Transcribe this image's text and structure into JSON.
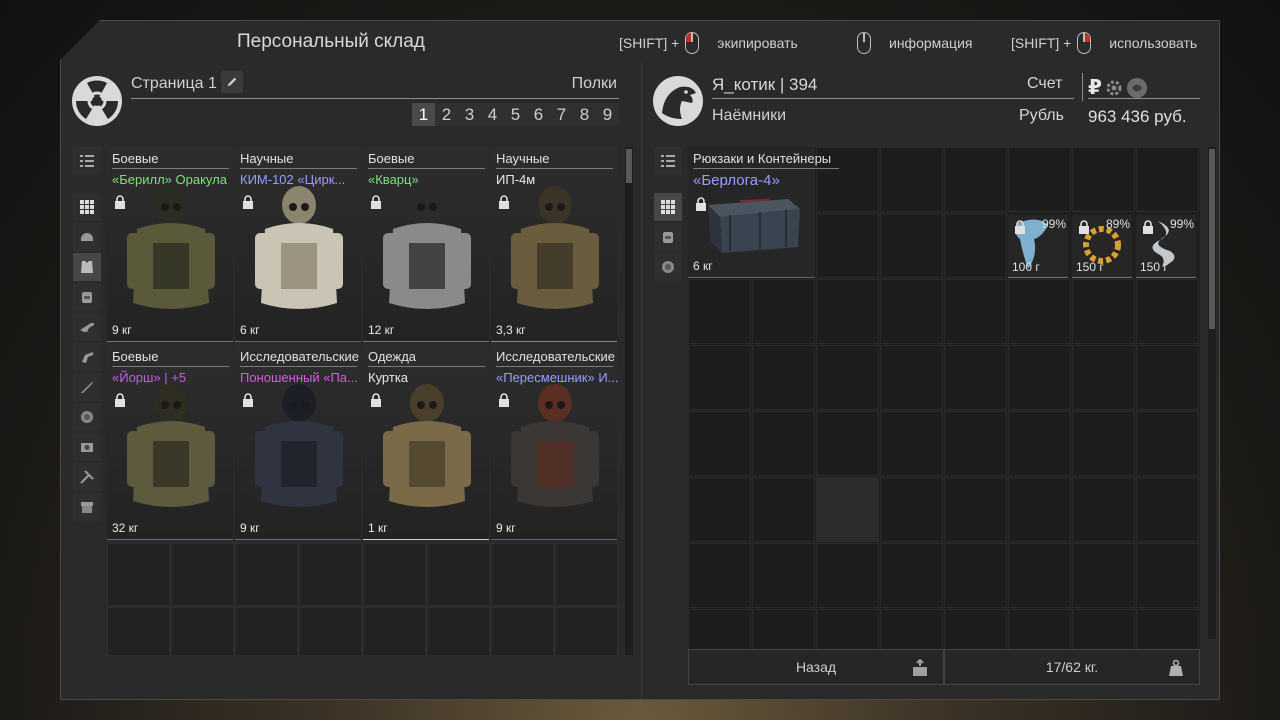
{
  "topbar": {
    "title": "Персональный склад",
    "hints": [
      {
        "prefix": "[SHIFT] +",
        "mouse": "left",
        "label": "экипировать"
      },
      {
        "prefix": "",
        "mouse": "none",
        "label": "информация"
      },
      {
        "prefix": "[SHIFT] +",
        "mouse": "right",
        "label": "использовать"
      }
    ]
  },
  "left": {
    "page_label": "Страница 1",
    "shelves_label": "Полки",
    "pages": [
      "1",
      "2",
      "3",
      "4",
      "5",
      "6",
      "7",
      "8",
      "9"
    ],
    "active_page": "1",
    "sidebar_icons": [
      "list-icon",
      "grid-icon",
      "helmet-icon",
      "armor-icon",
      "backpack-icon",
      "rifle-icon",
      "pistol-icon",
      "knife-icon",
      "artifact-icon",
      "device-icon",
      "tools-icon",
      "box-icon"
    ],
    "items": [
      {
        "cat": "Боевые",
        "name": "«Берилл» Оракула",
        "name_color": "#7fe07f",
        "weight": "9 кг",
        "border": "#3f9d3f",
        "body": "#5a5a3a",
        "accent": "#2c2c22"
      },
      {
        "cat": "Научные",
        "name": "КИМ-102 «Цирк...",
        "name_color": "#9c9cff",
        "weight": "6 кг",
        "border": "#5b5bb8",
        "body": "#c9c4b4",
        "accent": "#8c846f"
      },
      {
        "cat": "Боевые",
        "name": "«Кварц»",
        "name_color": "#7fe07f",
        "weight": "12 кг",
        "border": "#3f9d3f",
        "body": "#8a8a8a",
        "accent": "#2b2b2b"
      },
      {
        "cat": "Научные",
        "name": "ИП-4м",
        "name_color": "#e8e8e8",
        "weight": "3,3 кг",
        "border": "#8a8a8a",
        "body": "#6a5d3e",
        "accent": "#3a3326"
      },
      {
        "cat": "Боевые",
        "name": "«Йорш» | +5",
        "name_color": "#c060e0",
        "weight": "32 кг",
        "border": "#a040c0",
        "body": "#5d5a3e",
        "accent": "#2f2c22"
      },
      {
        "cat": "Исследовательские",
        "name": "Поношенный «Па...",
        "name_color": "#d060e0",
        "weight": "9 кг",
        "border": "#a040c0",
        "body": "#2f3440",
        "accent": "#1c1f26"
      },
      {
        "cat": "Одежда",
        "name": "Куртка",
        "name_color": "#e8e8e8",
        "weight": "1 кг",
        "border": "#d0d0d0",
        "body": "#7a6a48",
        "accent": "#4a3f2a"
      },
      {
        "cat": "Исследовательские",
        "name": "«Пересмешник» И...",
        "name_color": "#9c9cff",
        "weight": "9 кг",
        "border": "#5b5bb8",
        "body": "#3a3734",
        "accent": "#5a2e22"
      }
    ]
  },
  "right": {
    "user": "Я_котик | 394",
    "faction": "Наёмники",
    "account_label": "Счет",
    "currency_label": "Рубль",
    "money": "963 436 руб.",
    "sidebar_icons": [
      "list-icon",
      "grid-icon",
      "backpack-icon",
      "artifact-icon"
    ],
    "backpack": {
      "cat": "Рюкзаки и Контейнеры",
      "name": "«Берлога-4»",
      "weight": "6 кг"
    },
    "artifacts": [
      {
        "pct": "99%",
        "weight": "100 г",
        "color": "#7fb0d0",
        "icon": "claw-artifact-icon"
      },
      {
        "pct": "89%",
        "weight": "150 г",
        "color": "#d8a030",
        "icon": "ring-artifact-icon"
      },
      {
        "pct": "99%",
        "weight": "150 г",
        "color": "#c0c8d0",
        "icon": "spiral-artifact-icon"
      }
    ],
    "back_label": "Назад",
    "capacity": "17/62 кг."
  }
}
